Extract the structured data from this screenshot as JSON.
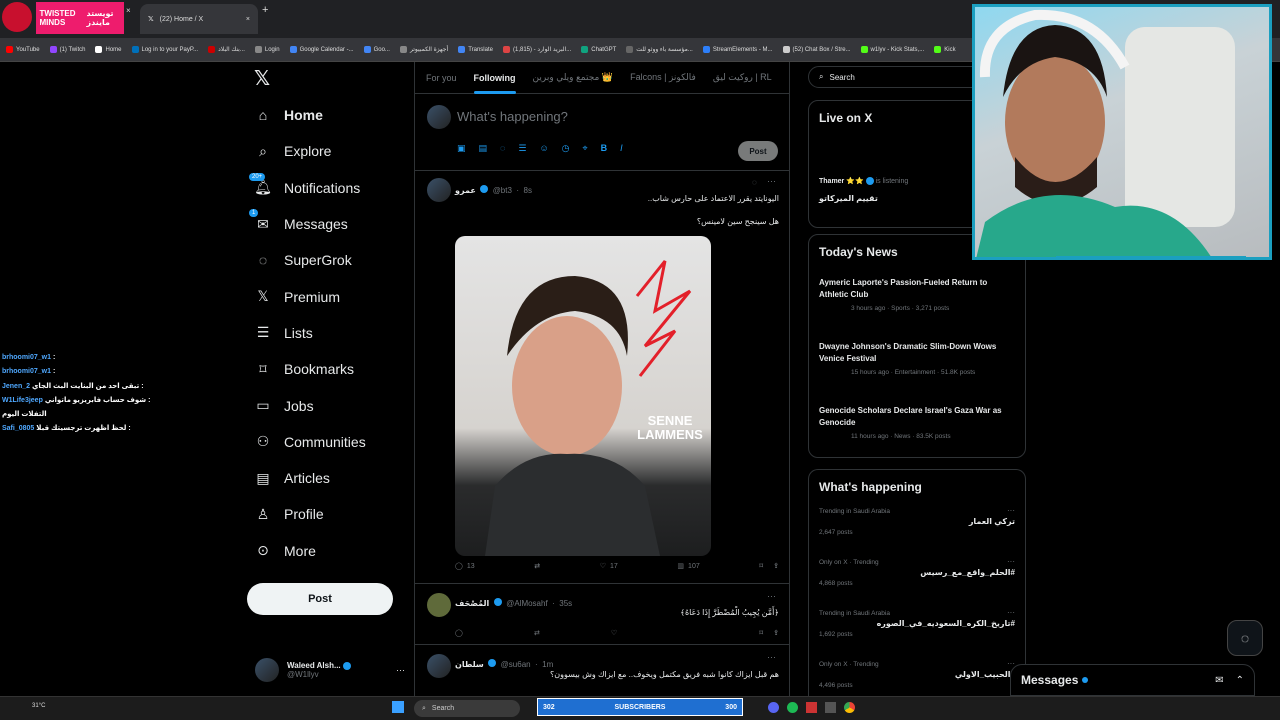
{
  "browser": {
    "channel_badge_en": "TWISTED MINDS",
    "channel_badge_ar": "تويستد مايندز",
    "active_tab": "(22) Home / X",
    "bookmarks": [
      "YouTube",
      "(1) Twitch",
      "Home",
      "Log in to your PayP...",
      "بنك البلاد...",
      "Login",
      "Google Calendar -...",
      "Goo...",
      "أجهزة الكمبيوتر",
      "Translate",
      "البريد الوارد - (1,815)...",
      "ChatGPT",
      "مؤسسة باء ووثو للت...",
      "StreamElements - M...",
      "(52) Chat Box / Stre...",
      "w1lyv - Kick Stats,...",
      "Kick"
    ]
  },
  "nav": {
    "items": [
      {
        "label": "Home",
        "icon": "home-icon"
      },
      {
        "label": "Explore",
        "icon": "search-icon"
      },
      {
        "label": "Notifications",
        "icon": "bell-icon",
        "badge": "20+"
      },
      {
        "label": "Messages",
        "icon": "envelope-icon",
        "badge": "1"
      },
      {
        "label": "SuperGrok",
        "icon": "grok-icon"
      },
      {
        "label": "Premium",
        "icon": "x-logo-icon"
      },
      {
        "label": "Lists",
        "icon": "list-icon"
      },
      {
        "label": "Bookmarks",
        "icon": "bookmark-icon"
      },
      {
        "label": "Jobs",
        "icon": "briefcase-icon"
      },
      {
        "label": "Communities",
        "icon": "people-icon"
      },
      {
        "label": "Articles",
        "icon": "article-icon"
      },
      {
        "label": "Profile",
        "icon": "person-icon"
      },
      {
        "label": "More",
        "icon": "more-circle-icon"
      }
    ],
    "post_button": "Post",
    "account_name": "Waleed Alsh...",
    "account_handle": "@W1llyv"
  },
  "feed": {
    "tabs": [
      "For you",
      "Following",
      "مجتمع ويلي وبرين 👑",
      "Falcons | فالكونز",
      "روكيت ليق | RL"
    ],
    "composer_placeholder": "What's happening?",
    "composer_post": "Post",
    "tweets": [
      {
        "name": "عمرو",
        "handle": "@bt3",
        "time": "8s",
        "lines": [
          "اليونايتد يقرر الاعتماد على حارس شاب..",
          "هل سينجح سين لامينس؟"
        ],
        "image_text": "SENNE LAMMENS",
        "replies": "13",
        "likes": "17",
        "views": "107"
      },
      {
        "name": "المُصْحَف",
        "handle": "@AlMosahf",
        "time": "35s",
        "lines": [
          "﴿أَمَّن يُجِيبُ الْمُضْطَرَّ إِذَا دَعَاهُ﴾"
        ]
      },
      {
        "name": "سلطان",
        "handle": "@su6an",
        "time": "1m",
        "lines": [
          "هم قبل ايزاك كانوا شبه فريق مكتمل ويخوف.. مع ايزاك وش بيسوون؟"
        ]
      }
    ]
  },
  "sidebar": {
    "search_placeholder": "Search",
    "live": {
      "title": "Live on X",
      "host": "Thamer ⭐⭐",
      "status": "is listening",
      "space_title": "تقييم الميركاتو"
    },
    "news": {
      "title": "Today's News",
      "items": [
        {
          "headline": "Aymeric Laporte's Passion-Fueled Return to Athletic Club",
          "meta": "3 hours ago · Sports · 3,271 posts"
        },
        {
          "headline": "Dwayne Johnson's Dramatic Slim-Down Wows Venice Festival",
          "meta": "15 hours ago · Entertainment · 51.8K posts"
        },
        {
          "headline": "Genocide Scholars Declare Israel's Gaza War as Genocide",
          "meta": "11 hours ago · News · 83.5K posts"
        }
      ]
    },
    "trends": {
      "title": "What's happening",
      "items": [
        {
          "context": "Trending in Saudi Arabia",
          "topic": "تركي العمار",
          "posts": "2,647 posts"
        },
        {
          "context": "Only on X · Trending",
          "topic": "#الحلم_واقع_مع_رسيس",
          "posts": "4,868 posts"
        },
        {
          "context": "Trending in Saudi Arabia",
          "topic": "#تاريخ_الكره_السعوديه_في_الصوره",
          "posts": "1,692 posts"
        },
        {
          "context": "Only on X · Trending",
          "topic": "#الحبيب_الاولي",
          "posts": "4,496 posts"
        }
      ]
    },
    "messages_dock": "Messages"
  },
  "chat_overlay": [
    {
      "user": "brhoomi07_w1",
      "msg": ":"
    },
    {
      "user": "brhoomi07_w1",
      "msg": ":"
    },
    {
      "user": "Jenen_2",
      "msg": "تبقى احد من البنايت البث الجاي :"
    },
    {
      "user": "W1Life3jeep",
      "msg": "شوف حساب فابريزيو ماتواني :"
    },
    {
      "user": "",
      "msg": "التفلات اليوم"
    },
    {
      "user": "Safi_0805",
      "msg": "لحظ اظهرت ترجسيتك قبلا :"
    }
  ],
  "taskbar": {
    "search": "Search",
    "subs_left": "302",
    "subs_label": "SUBSCRIBERS",
    "subs_right": "300",
    "weather": "31°C"
  },
  "colors": {
    "accent": "#1d9bf0",
    "background": "#000000",
    "border": "#2f3336",
    "muted": "#71767b",
    "badge_pink": "#ee1c6d"
  }
}
